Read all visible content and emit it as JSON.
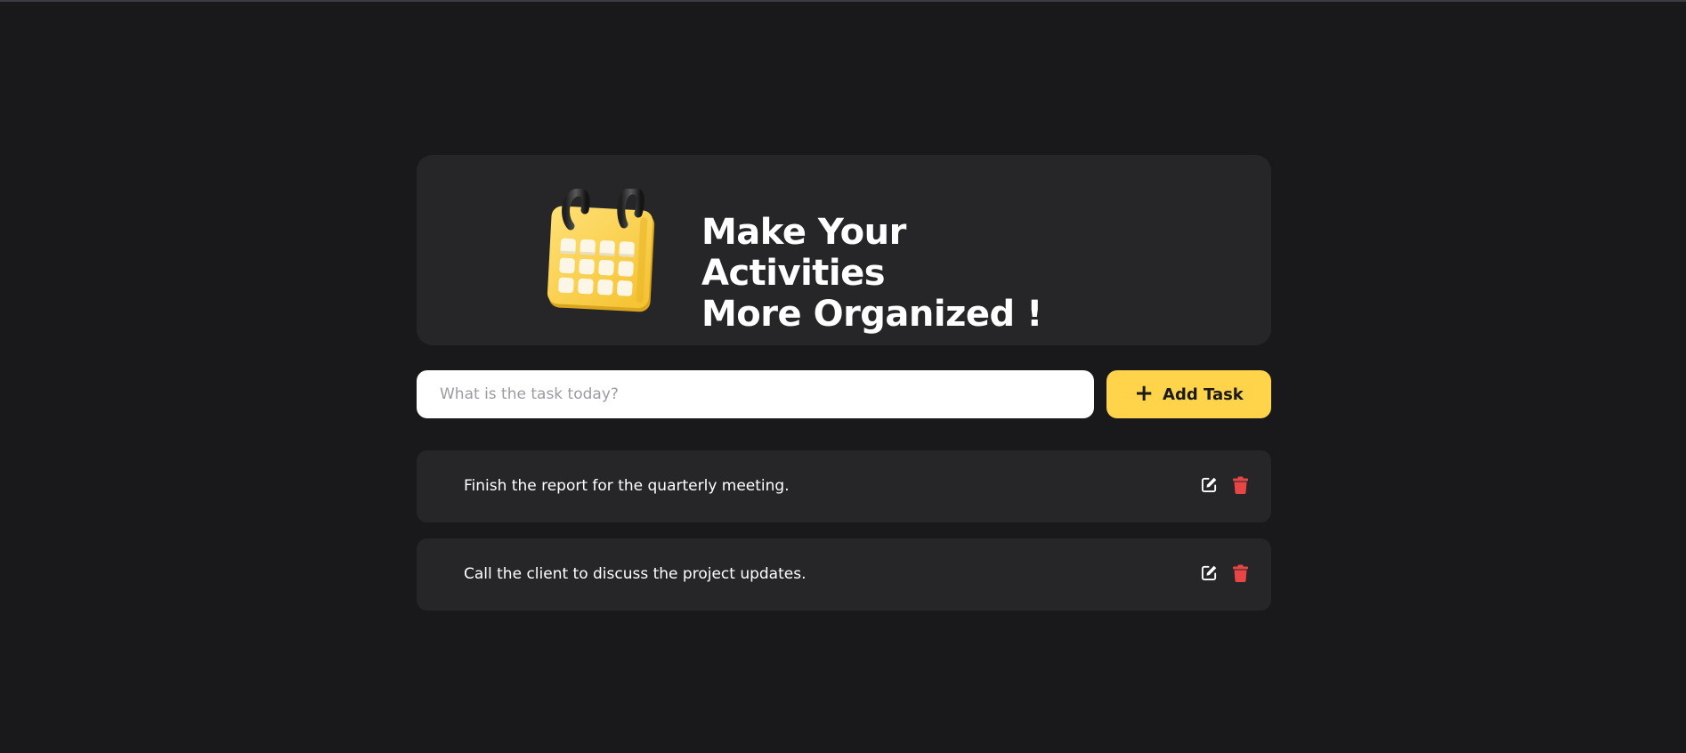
{
  "hero": {
    "title_line1": "Make Your Activities",
    "title_line2": "More Organized !",
    "illustration": "calendar-icon"
  },
  "input": {
    "value": "",
    "placeholder": "What is the task today?"
  },
  "add_button": {
    "label": "Add Task",
    "icon": "plus-icon"
  },
  "tasks": [
    {
      "text": "Finish the report for the quarterly meeting.",
      "actions": [
        "edit-icon",
        "trash-icon"
      ]
    },
    {
      "text": "Call the client to discuss the project updates.",
      "actions": [
        "edit-icon",
        "trash-icon"
      ]
    }
  ],
  "colors": {
    "background": "#19191b",
    "card": "#262629",
    "accent": "#ffd34a",
    "delete": "#e84545",
    "text": "#ffffff"
  }
}
